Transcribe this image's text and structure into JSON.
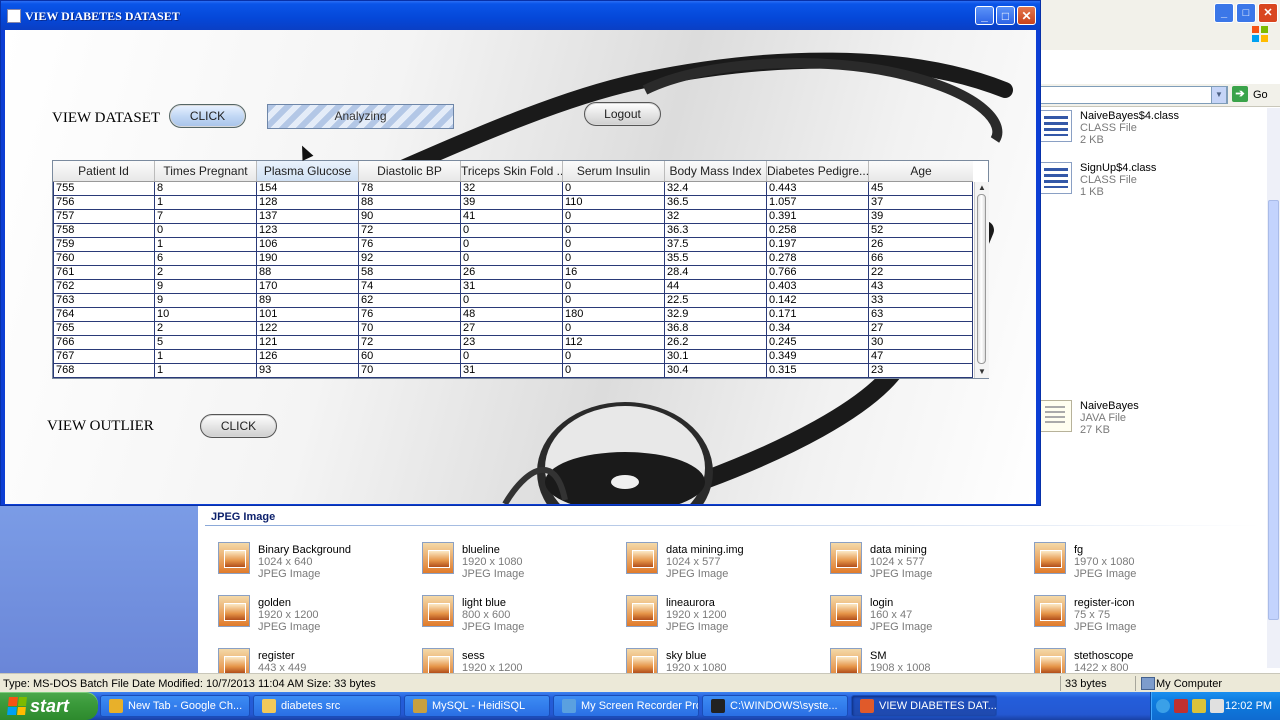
{
  "app": {
    "title": "VIEW DIABETES DATASET",
    "view_dataset_label": "VIEW DATASET",
    "view_dataset_button": "CLICK",
    "progress_label": "Analyzing",
    "logout_button": "Logout",
    "view_outlier_label": "VIEW OUTLIER",
    "view_outlier_button": "CLICK",
    "window_buttons": {
      "minimize": "_",
      "maximize": "□",
      "close": "✕"
    }
  },
  "table": {
    "columns": [
      "Patient Id",
      "Times Pregnant",
      "Plasma Glucose",
      "Diastolic BP",
      "Triceps Skin Fold ...",
      "Serum Insulin",
      "Body Mass Index",
      "Diabetes Pedigre...",
      "Age"
    ],
    "rows": [
      [
        "755",
        "8",
        "154",
        "78",
        "32",
        "0",
        "32.4",
        "0.443",
        "45"
      ],
      [
        "756",
        "1",
        "128",
        "88",
        "39",
        "110",
        "36.5",
        "1.057",
        "37"
      ],
      [
        "757",
        "7",
        "137",
        "90",
        "41",
        "0",
        "32",
        "0.391",
        "39"
      ],
      [
        "758",
        "0",
        "123",
        "72",
        "0",
        "0",
        "36.3",
        "0.258",
        "52"
      ],
      [
        "759",
        "1",
        "106",
        "76",
        "0",
        "0",
        "37.5",
        "0.197",
        "26"
      ],
      [
        "760",
        "6",
        "190",
        "92",
        "0",
        "0",
        "35.5",
        "0.278",
        "66"
      ],
      [
        "761",
        "2",
        "88",
        "58",
        "26",
        "16",
        "28.4",
        "0.766",
        "22"
      ],
      [
        "762",
        "9",
        "170",
        "74",
        "31",
        "0",
        "44",
        "0.403",
        "43"
      ],
      [
        "763",
        "9",
        "89",
        "62",
        "0",
        "0",
        "22.5",
        "0.142",
        "33"
      ],
      [
        "764",
        "10",
        "101",
        "76",
        "48",
        "180",
        "32.9",
        "0.171",
        "63"
      ],
      [
        "765",
        "2",
        "122",
        "70",
        "27",
        "0",
        "36.8",
        "0.34",
        "27"
      ],
      [
        "766",
        "5",
        "121",
        "72",
        "23",
        "112",
        "26.2",
        "0.245",
        "30"
      ],
      [
        "767",
        "1",
        "126",
        "60",
        "0",
        "0",
        "30.1",
        "0.349",
        "47"
      ],
      [
        "768",
        "1",
        "93",
        "70",
        "31",
        "0",
        "30.4",
        "0.315",
        "23"
      ]
    ]
  },
  "explorer": {
    "address_go": "Go",
    "files_right": [
      {
        "name": "NaiveBayes$4.class",
        "type": "CLASS File",
        "size": "2 KB"
      },
      {
        "name": "SignUp$4.class",
        "type": "CLASS File",
        "size": "1 KB"
      },
      {
        "name": "NaiveBayes",
        "type": "JAVA File",
        "size": "27 KB"
      }
    ],
    "group_label": "JPEG Image",
    "images": [
      {
        "name": "Binary Background",
        "dims": "1024 x 640",
        "type": "JPEG Image"
      },
      {
        "name": "blueline",
        "dims": "1920 x 1080",
        "type": "JPEG Image"
      },
      {
        "name": "data mining.img",
        "dims": "1024 x 577",
        "type": "JPEG Image"
      },
      {
        "name": "data mining",
        "dims": "1024 x 577",
        "type": "JPEG Image"
      },
      {
        "name": "fg",
        "dims": "1970 x 1080",
        "type": "JPEG Image"
      },
      {
        "name": "golden",
        "dims": "1920 x 1200",
        "type": "JPEG Image"
      },
      {
        "name": "light blue",
        "dims": "800 x 600",
        "type": "JPEG Image"
      },
      {
        "name": "lineaurora",
        "dims": "1920 x 1200",
        "type": "JPEG Image"
      },
      {
        "name": "login",
        "dims": "160 x 47",
        "type": "JPEG Image"
      },
      {
        "name": "register-icon",
        "dims": "75 x 75",
        "type": "JPEG Image"
      },
      {
        "name": "register",
        "dims": "443 x 449",
        "type": ""
      },
      {
        "name": "sess",
        "dims": "1920 x 1200",
        "type": ""
      },
      {
        "name": "sky blue",
        "dims": "1920 x 1080",
        "type": ""
      },
      {
        "name": "SM",
        "dims": "1908 x 1008",
        "type": ""
      },
      {
        "name": "stethoscope",
        "dims": "1422 x 800",
        "type": ""
      }
    ],
    "status_text": "Type: MS-DOS Batch File Date Modified: 10/7/2013 11:04 AM Size: 33 bytes",
    "status_size": "33 bytes",
    "status_location": "My Computer"
  },
  "taskbar": {
    "start_label": "start",
    "tasks": [
      {
        "label": "New Tab - Google Ch...",
        "icon": "chrome-icon",
        "color": "#e8b02a"
      },
      {
        "label": "diabetes src",
        "icon": "folder-icon",
        "color": "#f2c95a"
      },
      {
        "label": "MySQL - HeidiSQL",
        "icon": "heidisql-icon",
        "color": "#c8a040"
      },
      {
        "label": "My Screen Recorder Pro",
        "icon": "recorder-icon",
        "color": "#5aa0e0"
      },
      {
        "label": "C:\\WINDOWS\\syste...",
        "icon": "cmd-icon",
        "color": "#222222"
      },
      {
        "label": "VIEW DIABETES DAT...",
        "icon": "java-icon",
        "color": "#e05a2a"
      }
    ],
    "clock": "12:02 PM"
  }
}
